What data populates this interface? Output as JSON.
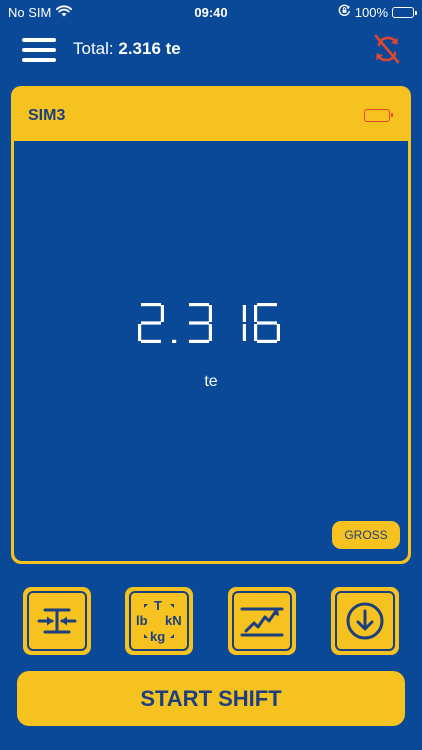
{
  "status_bar": {
    "carrier": "No SIM",
    "time": "09:40",
    "battery_percent": "100%"
  },
  "header": {
    "total_label": "Total:",
    "total_value": "2.316 te"
  },
  "device": {
    "name": "SIM3",
    "battery_level": 0.25,
    "reading": "2.316",
    "unit": "te",
    "mode_button": "GROSS"
  },
  "tools": {
    "units": {
      "t": "T",
      "lb": "lb",
      "kn": "kN",
      "kg": "kg"
    }
  },
  "actions": {
    "start_label": "START SHIFT"
  },
  "colors": {
    "background": "#0a4898",
    "accent": "#f5c220",
    "dark_text": "#1c3f80",
    "warning": "#e0472c"
  },
  "icons": [
    "wifi-icon",
    "orientation-lock-icon",
    "battery-icon",
    "menu-icon",
    "sync-off-icon",
    "battery-low-icon",
    "zero-icon",
    "unit-select-icon",
    "peak-hold-icon",
    "download-icon"
  ]
}
